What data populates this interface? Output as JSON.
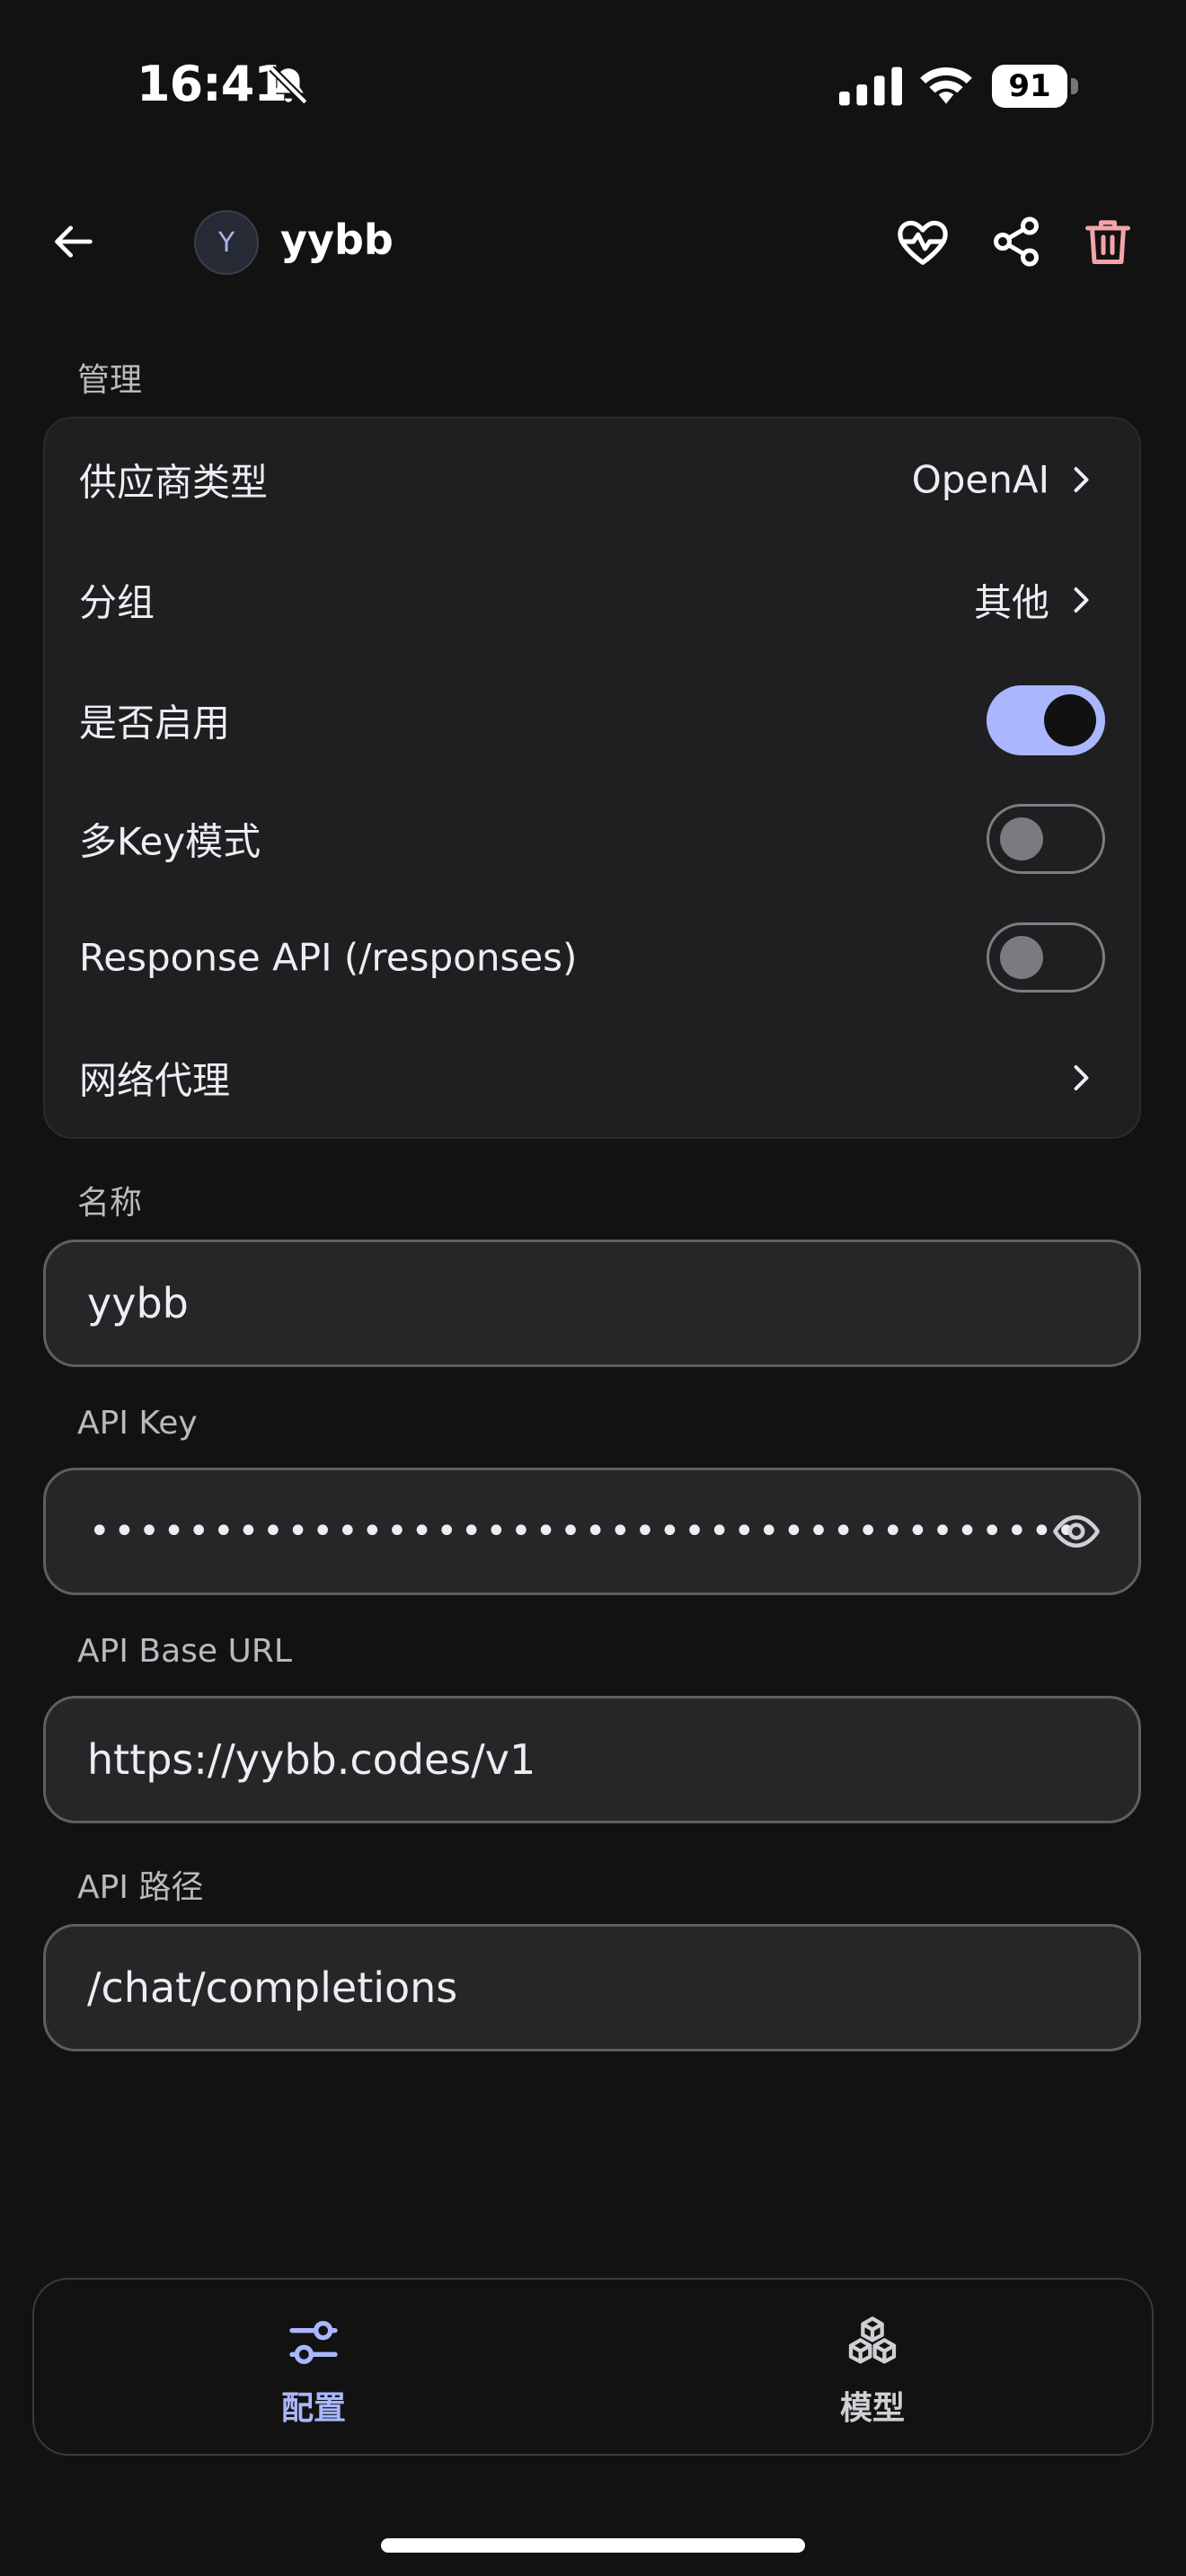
{
  "status": {
    "time": "16:41",
    "battery": "91"
  },
  "header": {
    "avatar_letter": "Y",
    "title": "yybb"
  },
  "management": {
    "section_label": "管理",
    "rows": [
      {
        "label": "供应商类型",
        "value": "OpenAI"
      },
      {
        "label": "分组",
        "value": "其他"
      },
      {
        "label": "是否启用",
        "toggle": true
      },
      {
        "label": "多Key模式",
        "toggle": false
      },
      {
        "label": "Response API (/responses)",
        "toggle": false
      },
      {
        "label": "网络代理",
        "value": ""
      }
    ]
  },
  "fields": {
    "name": {
      "label": "名称",
      "value": "yybb"
    },
    "api_key": {
      "label": "API Key",
      "value": "••••••••••••••••••••••••••••••••••••••••"
    },
    "base_url": {
      "label": "API Base URL",
      "value": "https://yybb.codes/v1"
    },
    "api_path": {
      "label": "API 路径",
      "value": "/chat/completions"
    }
  },
  "bottom_nav": {
    "items": [
      {
        "label": "配置",
        "active": true,
        "icon": "sliders-icon"
      },
      {
        "label": "模型",
        "active": false,
        "icon": "cubes-icon"
      }
    ]
  },
  "colors": {
    "accent": "#aab7ff",
    "danger": "#f3a3a8",
    "background": "#121212",
    "card": "#1f1f21"
  }
}
